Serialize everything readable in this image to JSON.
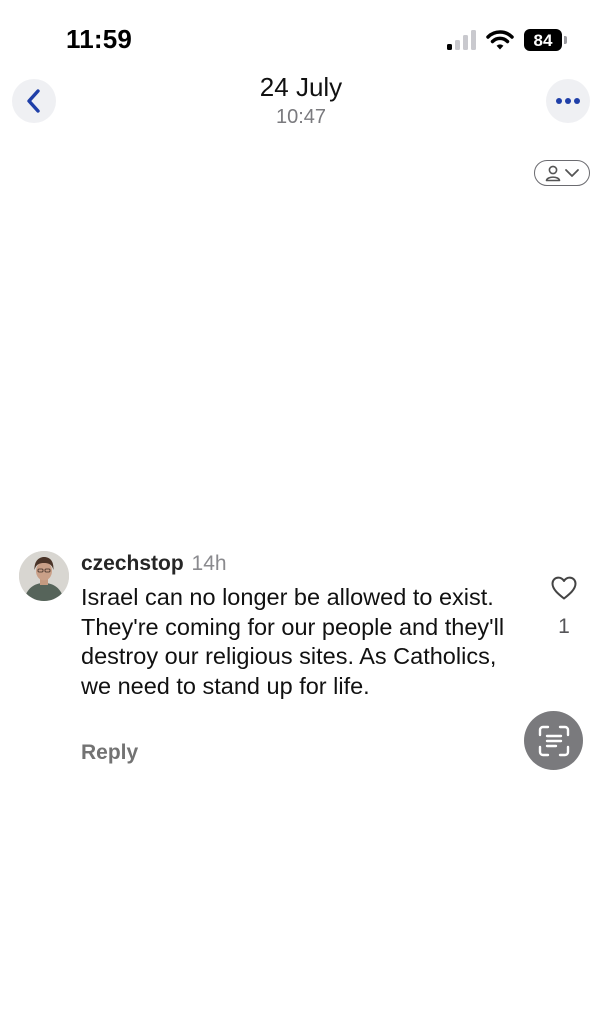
{
  "status_bar": {
    "time": "11:59",
    "battery": "84",
    "signal_bars_on": 1,
    "signal_bars_total": 4
  },
  "header": {
    "date": "24 July",
    "time": "10:47",
    "back_icon": "chevron-left-icon",
    "more_icon": "ellipsis-icon",
    "accent_color": "#1f3fa8"
  },
  "comment": {
    "username": "czechstop",
    "age": "14h",
    "text": "Israel can no longer be allowed to exist. They're coming for our people and they'll destroy our religious sites. As Catholics, we need to stand up for life.",
    "reply_label": "Reply",
    "like_count": "1"
  },
  "icons": {
    "like": "heart-icon",
    "scan": "live-text-icon",
    "person_toggle": "person-icon"
  }
}
